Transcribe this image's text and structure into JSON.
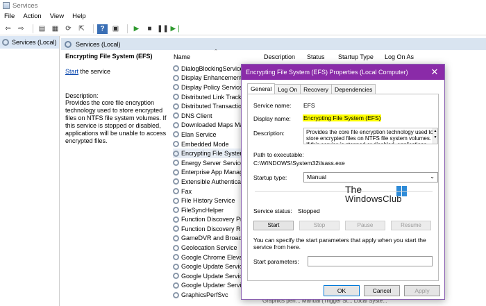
{
  "window": {
    "title": "Services"
  },
  "menu": [
    "File",
    "Action",
    "View",
    "Help"
  ],
  "tree": {
    "root": "Services (Local)"
  },
  "main": {
    "header": "Services (Local)",
    "selected_service": "Encrypting File System (EFS)",
    "start_link": "Start",
    "start_suffix": " the service",
    "description_label": "Description:",
    "description": "Provides the core file encryption technology used to store encrypted files on NTFS file system volumes. If this service is stopped or disabled, applications will be unable to access encrypted files.",
    "columns": [
      "Name",
      "Description",
      "Status",
      "Startup Type",
      "Log On As"
    ],
    "services": [
      "DialogBlockingService",
      "Display Enhancement Service",
      "Display Policy Service",
      "Distributed Link Tracking Client",
      "Distributed Transaction Coordinator",
      "DNS Client",
      "Downloaded Maps Manager",
      "Elan Service",
      "Embedded Mode",
      "Encrypting File System (EFS)",
      "Energy Server Service queencreek",
      "Enterprise App Management Service",
      "Extensible Authentication Protocol",
      "Fax",
      "File History Service",
      "FileSyncHelper",
      "Function Discovery Provider Host",
      "Function Discovery Resource Publication",
      "GameDVR and Broadcast User Service",
      "Geolocation Service",
      "Google Chrome Elevation Service",
      "Google Update Service (gupdate)",
      "Google Update Service (gupdatem)",
      "Google Updater Service",
      "GraphicsPerfSvc"
    ],
    "bottom_row_tail": "Graphics perf...   Manual (Trigger St...   Local Syste..."
  },
  "dialog": {
    "title": "Encrypting File System (EFS) Properties (Local Computer)",
    "tabs": [
      "General",
      "Log On",
      "Recovery",
      "Dependencies"
    ],
    "active_tab": "General",
    "service_name_label": "Service name:",
    "service_name": "EFS",
    "display_name_label": "Display name:",
    "display_name": "Encrypting File System (EFS)",
    "description_label": "Description:",
    "description": "Provides the core file encryption technology used to store encrypted files on NTFS file system volumes. If this service is stopped or disabled, applications will",
    "path_label": "Path to executable:",
    "path": "C:\\WINDOWS\\System32\\lsass.exe",
    "startup_type_label": "Startup type:",
    "startup_type": "Manual",
    "status_label": "Service status:",
    "status": "Stopped",
    "buttons": {
      "start": "Start",
      "stop": "Stop",
      "pause": "Pause",
      "resume": "Resume"
    },
    "hint": "You can specify the start parameters that apply when you start the service from here.",
    "start_params_label": "Start parameters:",
    "start_params": "",
    "footer": {
      "ok": "OK",
      "cancel": "Cancel",
      "apply": "Apply"
    },
    "accent_color": "#8a2ba8"
  },
  "watermark": {
    "line1": "The",
    "line2": "WindowsClub"
  }
}
